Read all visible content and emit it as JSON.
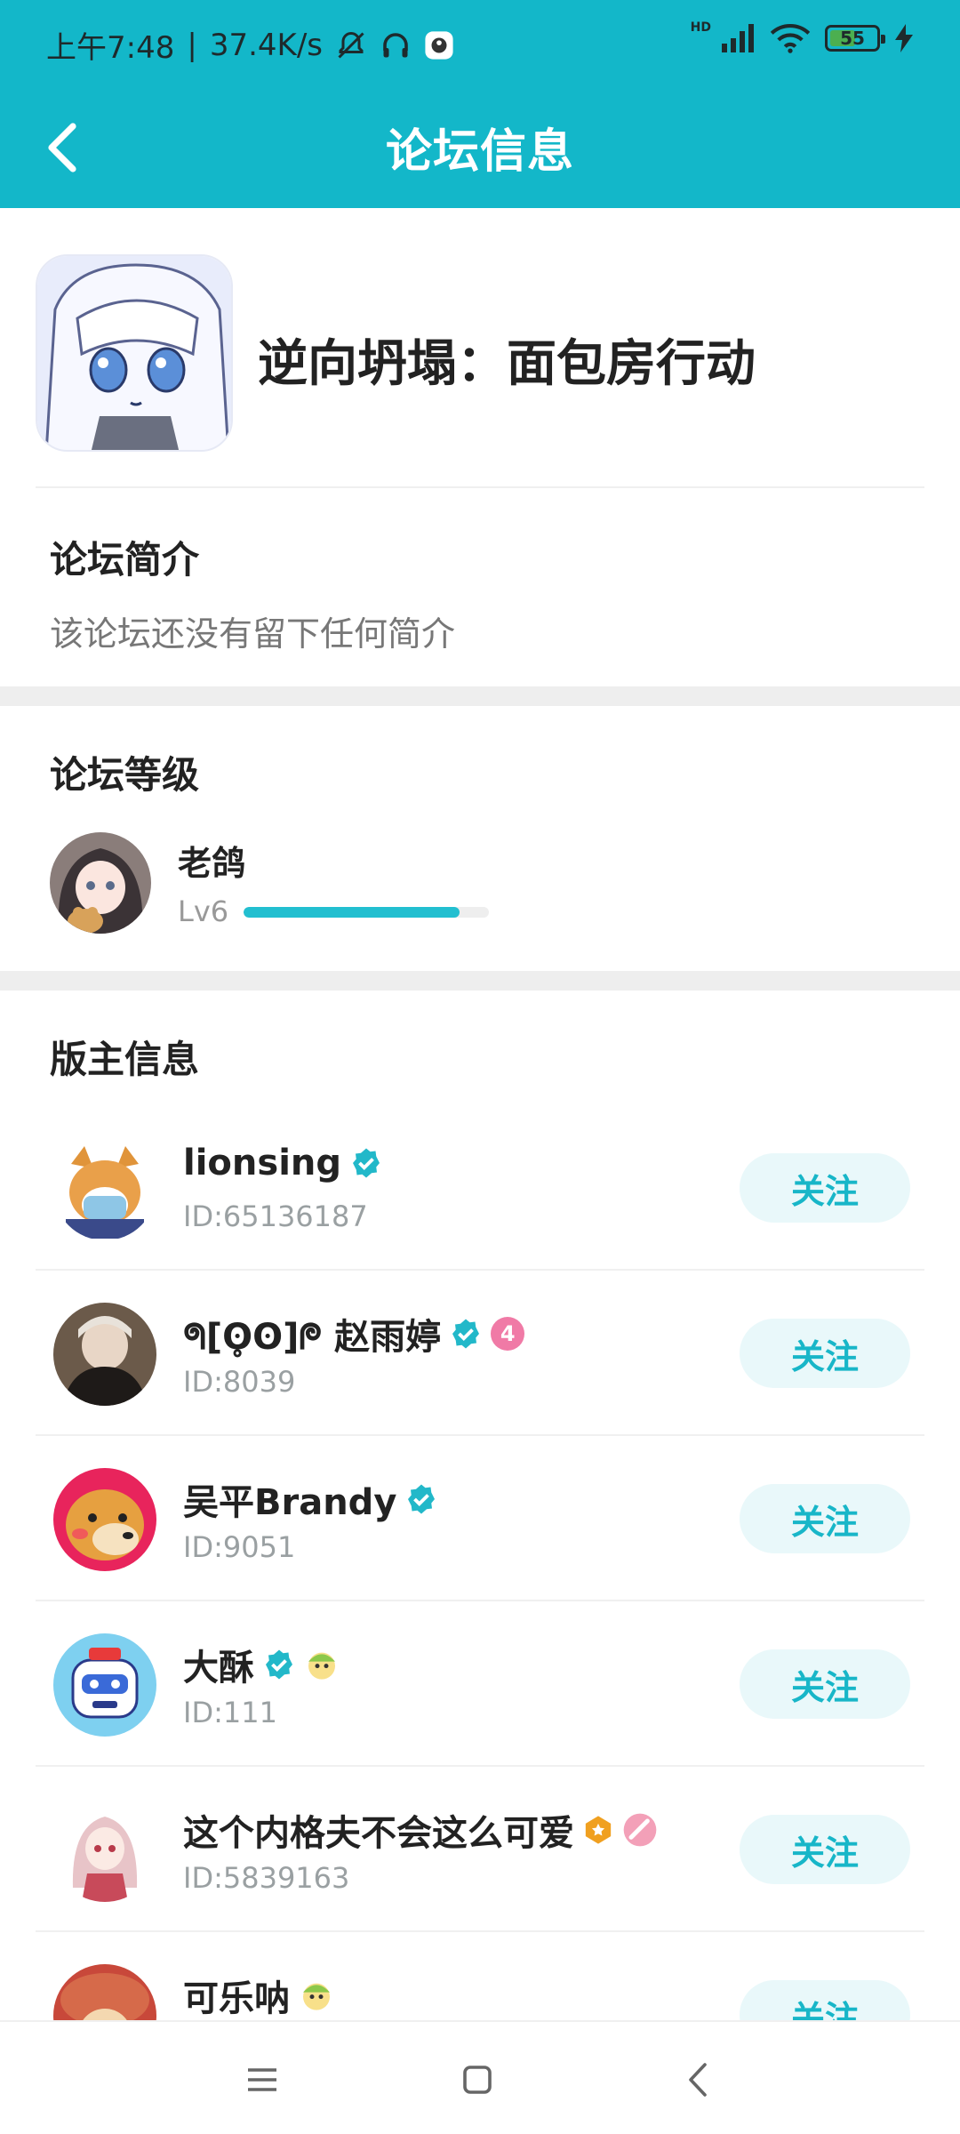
{
  "status": {
    "time": "上午7:48",
    "net_speed": "37.4K/s",
    "hd_label": "HD",
    "battery": "55"
  },
  "header": {
    "title": "论坛信息"
  },
  "forum": {
    "name": "逆向坍塌：面包房行动"
  },
  "intro": {
    "title": "论坛简介",
    "text": "该论坛还没有留下任何简介"
  },
  "level": {
    "title": "论坛等级",
    "name": "老鸽",
    "lv": "Lv6",
    "progress": 0.88
  },
  "moderators": {
    "title": "版主信息",
    "follow_label": "关注",
    "items": [
      {
        "name": "lionsing",
        "id": "ID:65136187"
      },
      {
        "name": "ᖗ[ʘ̥ʘ]ᖘ 赵雨婷",
        "id": "ID:8039",
        "badge": "4"
      },
      {
        "name": "吴平Brandy",
        "id": "ID:9051"
      },
      {
        "name": "大酥",
        "id": "ID:111"
      },
      {
        "name": "这个内格夫不会这么可爱",
        "id": "ID:5839163"
      },
      {
        "name": "可乐呐",
        "id": ""
      }
    ]
  },
  "colors": {
    "accent": "#13b7c9",
    "follow_bg": "#e9f8fa",
    "verified": "#22b8c9"
  },
  "icons": [
    "back-arrow-icon",
    "bell-off-icon",
    "headphones-icon",
    "signal-icon",
    "wifi-icon",
    "battery-icon",
    "charging-icon",
    "verified-icon",
    "menu-icon",
    "home-square-icon",
    "back-nav-icon"
  ]
}
